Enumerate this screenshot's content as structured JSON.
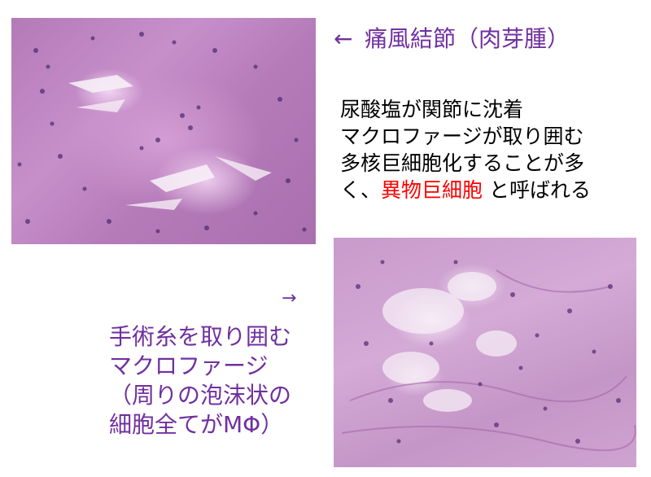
{
  "images": {
    "top_left": "gout-tophus-histology",
    "bottom_right": "suture-macrophage-histology"
  },
  "top_label": {
    "arrow": "←",
    "text": "痛風結節（肉芽腫）"
  },
  "description": {
    "line1": "尿酸塩が関節に沈着",
    "line2": "マクロファージが取り囲む",
    "line3": "多核巨細胞化することが多",
    "line4_prefix": "く、",
    "line4_highlight": "異物巨細胞",
    "line4_suffix": " と呼ばれる"
  },
  "bottom_label": {
    "arrow": "→",
    "line1": "手術糸を取り囲む",
    "line2": "マクロファージ",
    "line3": "（周りの泡沫状の",
    "line4": "細胞全てがMΦ）"
  },
  "colors": {
    "label_purple": "#7030a0",
    "highlight_red": "#ff0000",
    "body_black": "#000000"
  }
}
